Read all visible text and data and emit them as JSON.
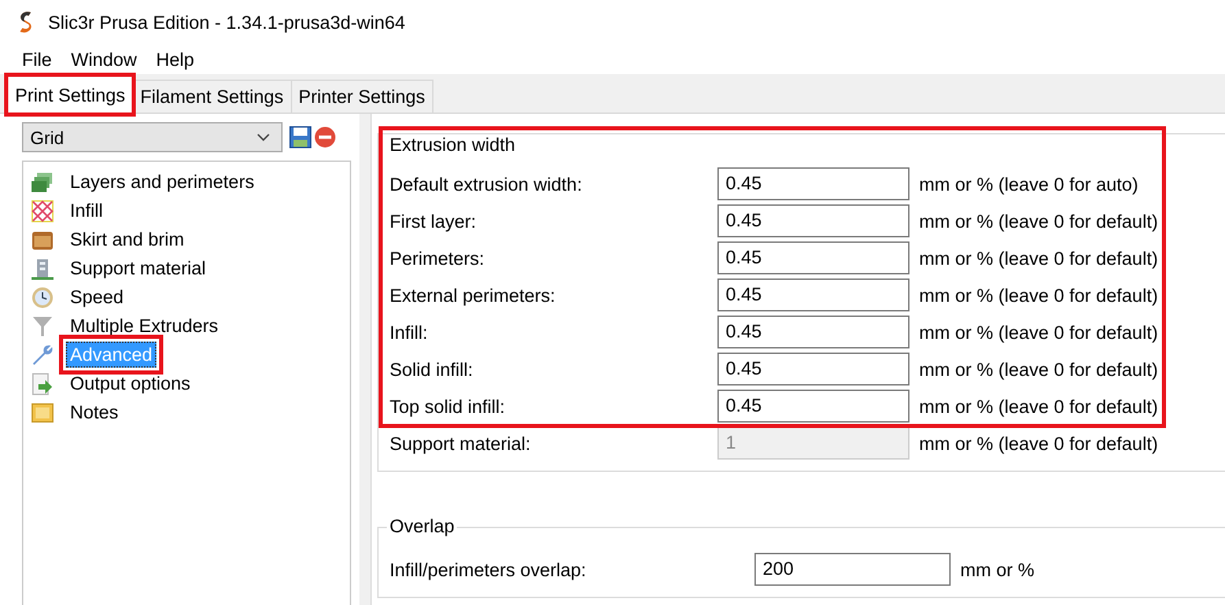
{
  "window": {
    "title": "Slic3r Prusa Edition - 1.34.1-prusa3d-win64"
  },
  "menu": [
    "File",
    "Window",
    "Help"
  ],
  "tabs": [
    {
      "label": "Print Settings",
      "selected": true,
      "highlighted": true
    },
    {
      "label": "Filament Settings",
      "selected": false,
      "highlighted": false
    },
    {
      "label": "Printer Settings",
      "selected": false,
      "highlighted": false
    }
  ],
  "preset": {
    "value": "Grid"
  },
  "pages": [
    {
      "label": "Layers and perimeters",
      "selected": false,
      "highlighted": false
    },
    {
      "label": "Infill",
      "selected": false,
      "highlighted": false
    },
    {
      "label": "Skirt and brim",
      "selected": false,
      "highlighted": false
    },
    {
      "label": "Support material",
      "selected": false,
      "highlighted": false
    },
    {
      "label": "Speed",
      "selected": false,
      "highlighted": false
    },
    {
      "label": "Multiple Extruders",
      "selected": false,
      "highlighted": false
    },
    {
      "label": "Advanced",
      "selected": true,
      "highlighted": true
    },
    {
      "label": "Output options",
      "selected": false,
      "highlighted": false
    },
    {
      "label": "Notes",
      "selected": false,
      "highlighted": false
    }
  ],
  "sections": [
    {
      "title": "Extrusion width",
      "rows": [
        {
          "label": "Default extrusion width:",
          "value": "0.45",
          "unit": "mm or % (leave 0 for auto)",
          "disabled": false,
          "highlighted": true
        },
        {
          "label": "First layer:",
          "value": "0.45",
          "unit": "mm or % (leave 0 for default)",
          "disabled": false,
          "highlighted": true
        },
        {
          "label": "Perimeters:",
          "value": "0.45",
          "unit": "mm or % (leave 0 for default)",
          "disabled": false,
          "highlighted": true
        },
        {
          "label": "External perimeters:",
          "value": "0.45",
          "unit": "mm or % (leave 0 for default)",
          "disabled": false,
          "highlighted": true
        },
        {
          "label": "Infill:",
          "value": "0.45",
          "unit": "mm or % (leave 0 for default)",
          "disabled": false,
          "highlighted": true
        },
        {
          "label": "Solid infill:",
          "value": "0.45",
          "unit": "mm or % (leave 0 for default)",
          "disabled": false,
          "highlighted": true
        },
        {
          "label": "Top solid infill:",
          "value": "0.45",
          "unit": "mm or % (leave 0 for default)",
          "disabled": false,
          "highlighted": true
        },
        {
          "label": "Support material:",
          "value": "1",
          "unit": "mm or % (leave 0 for default)",
          "disabled": true,
          "highlighted": false
        }
      ]
    },
    {
      "title": "Overlap",
      "rows": [
        {
          "label": "Infill/perimeters overlap:",
          "value": "200",
          "unit": "mm or %",
          "disabled": false,
          "highlighted": false
        }
      ]
    }
  ]
}
